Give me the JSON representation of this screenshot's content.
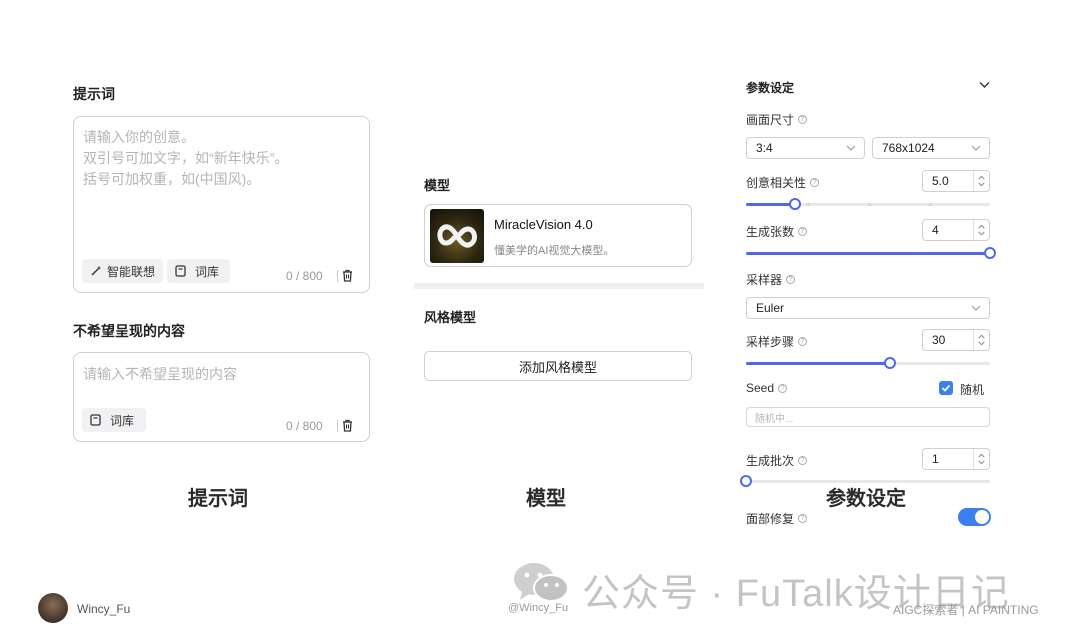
{
  "prompt": {
    "title": "提示词",
    "placeholder_lines": [
      "请输入你的创意。",
      "双引号可加文字，如“新年快乐”。",
      "括号可加权重，如(中国风)。"
    ],
    "smart_assoc_label": "智能联想",
    "lexicon_label": "词库",
    "counter": "0 / 800"
  },
  "negative": {
    "title": "不希望呈现的内容",
    "placeholder": "请输入不希望呈现的内容",
    "lexicon_label": "词库",
    "counter": "0 / 800"
  },
  "model": {
    "title": "模型",
    "name": "MiracleVision 4.0",
    "description": "懂美学的AI视觉大模型。",
    "style_title": "风格模型",
    "add_style_label": "添加风格模型"
  },
  "params": {
    "title": "参数设定",
    "canvas_size_label": "画面尺寸",
    "ratio": "3:4",
    "resolution": "768x1024",
    "creativity_label": "创意相关性",
    "creativity_value": "5.0",
    "creativity_fraction": 0.2,
    "count_label": "生成张数",
    "count_value": "4",
    "count_fraction": 1.0,
    "sampler_label": "采样器",
    "sampler_value": "Euler",
    "steps_label": "采样步骤",
    "steps_value": "30",
    "steps_fraction": 0.59,
    "seed_label": "Seed",
    "random_label": "随机",
    "seed_placeholder": "随机中...",
    "batch_label": "生成批次",
    "batch_value": "1",
    "batch_fraction": 0.0,
    "face_fix_label": "面部修复"
  },
  "captions": {
    "prompt": "提示词",
    "model": "模型",
    "params": "参数设定"
  },
  "footer": {
    "author": "Wincy_Fu",
    "handle": "@Wincy_Fu",
    "watermark": "公众号 · FuTalk设计日记",
    "right_text": "AIGC探索者 | AI PAINTING"
  },
  "colors": {
    "accent": "#4f68e8",
    "toggle": "#3b7ff0"
  }
}
